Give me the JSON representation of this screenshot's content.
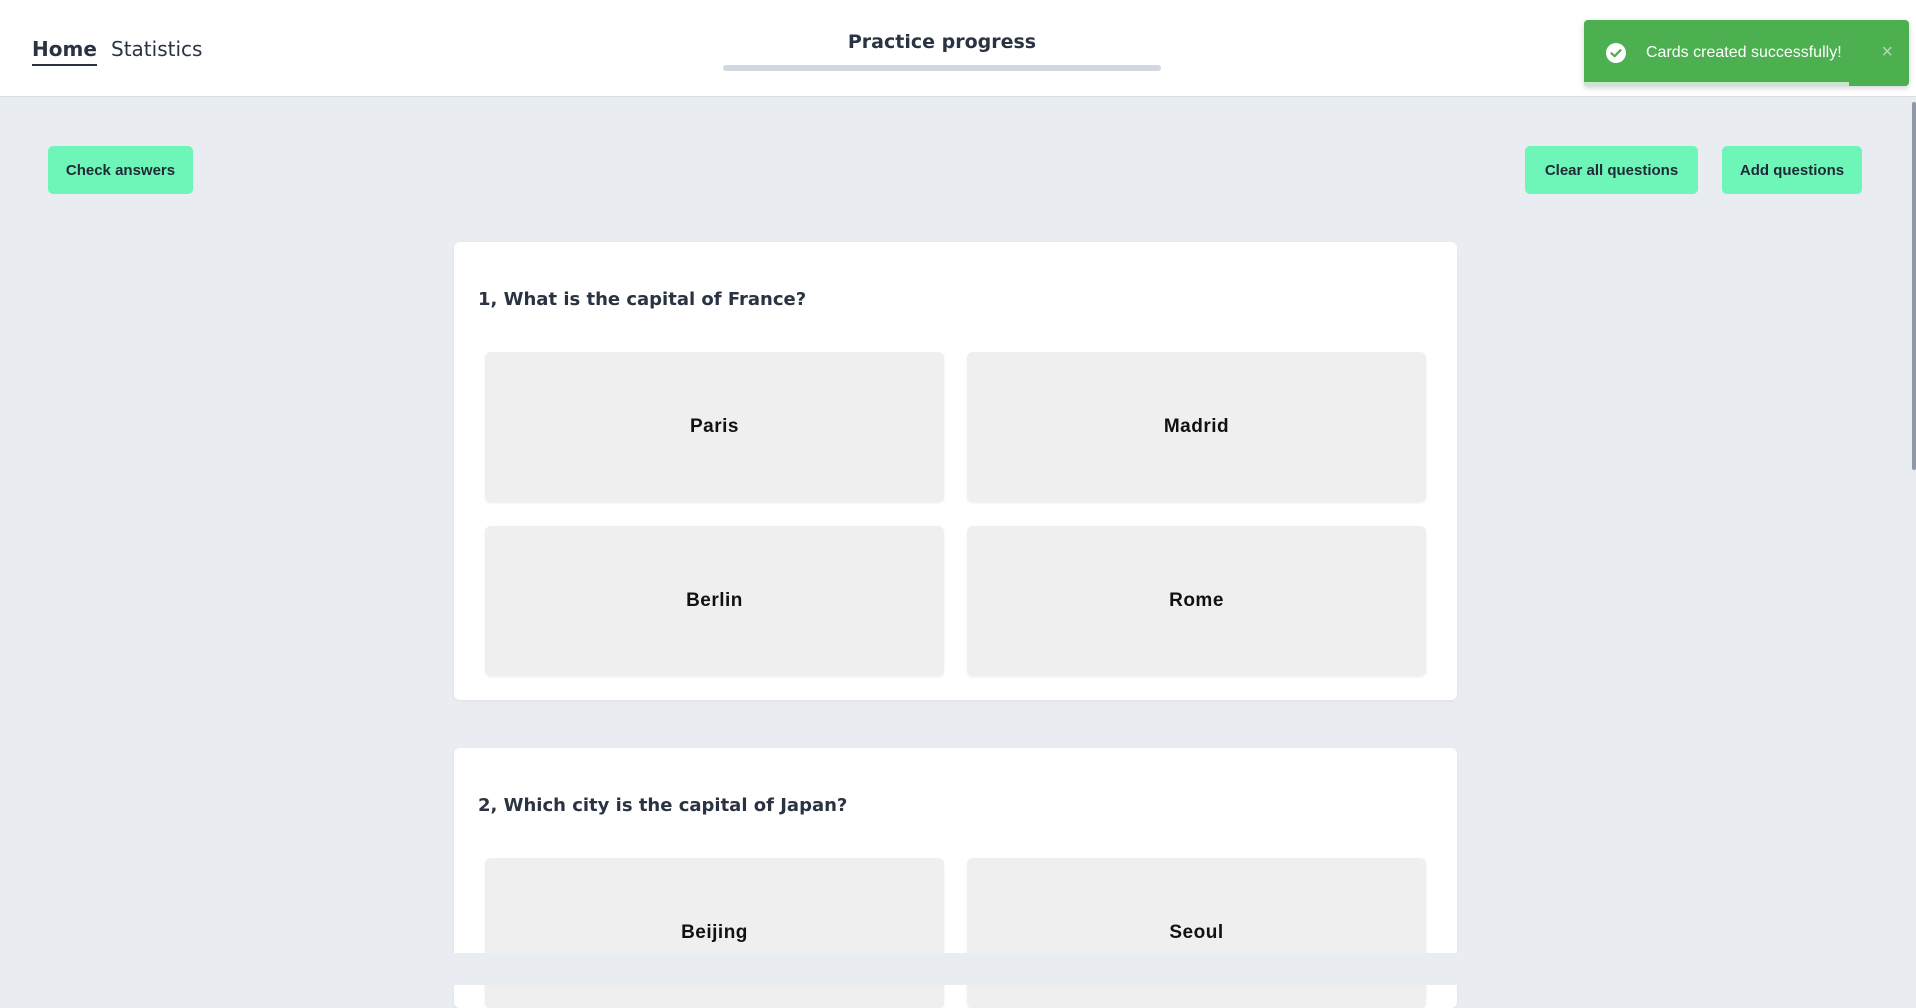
{
  "nav": {
    "home": "Home",
    "statistics": "Statistics"
  },
  "progress": {
    "title": "Practice progress",
    "value_percent": 0
  },
  "toast": {
    "message": "Cards created successfully!",
    "close": "×",
    "icon": "check-circle-icon",
    "color": "#4caf50"
  },
  "actions": {
    "check_answers": "Check answers",
    "clear_all": "Clear all questions",
    "add_questions": "Add questions",
    "button_color": "#6ef5b8"
  },
  "questions": [
    {
      "text": "1, What is the capital of France?",
      "answers": [
        "Paris",
        "Madrid",
        "Berlin",
        "Rome"
      ]
    },
    {
      "text": "2, Which city is the capital of Japan?",
      "answers": [
        "Beijing",
        "Seoul"
      ]
    }
  ]
}
